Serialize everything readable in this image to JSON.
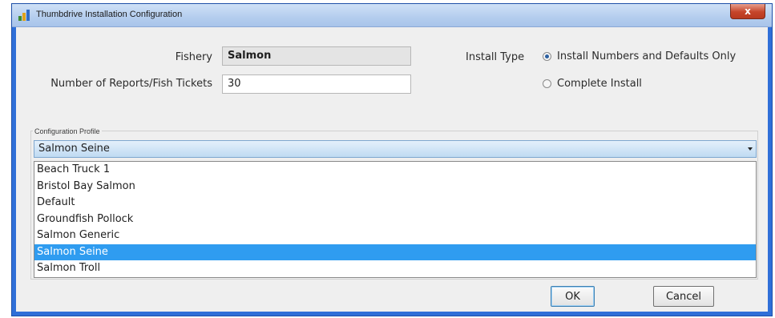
{
  "window": {
    "title": "Thumbdrive Installation Configuration",
    "close_glyph": "x",
    "icon": "app-icon"
  },
  "form": {
    "fishery_label": "Fishery",
    "fishery_value": "Salmon",
    "reports_label": "Number of Reports/Fish Tickets",
    "reports_value": "30",
    "install_type_label": "Install Type",
    "install_options": [
      {
        "label": "Install Numbers and Defaults Only",
        "checked": true
      },
      {
        "label": "Complete Install",
        "checked": false
      }
    ]
  },
  "profile": {
    "group_label": "Configuration Profile",
    "selected": "Salmon Seine",
    "options": [
      "Beach Truck 1",
      "Bristol Bay Salmon",
      "Default",
      "Groundfish Pollock",
      "Salmon Generic",
      "Salmon Seine",
      "Salmon Troll"
    ],
    "highlighted_index": 5
  },
  "buttons": {
    "ok_label": "OK",
    "cancel_label": "Cancel"
  },
  "colors": {
    "frame": "#2f6fd8",
    "selection": "#2f9cf0",
    "close": "#c5452a"
  }
}
